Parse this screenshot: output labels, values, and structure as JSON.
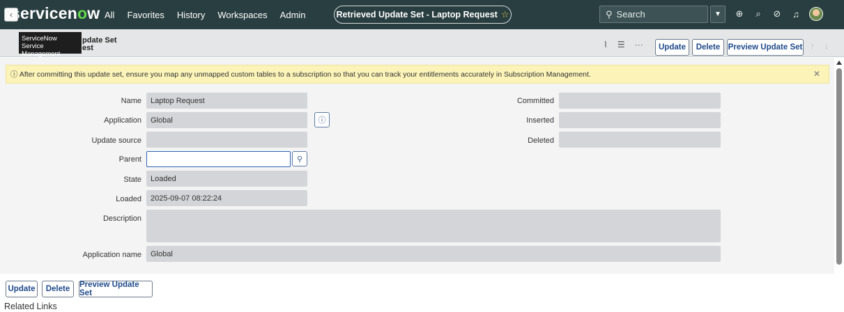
{
  "nav": {
    "logo_pre": "servicen",
    "logo_o": "o",
    "logo_post": "w",
    "links": [
      "All",
      "Favorites",
      "History",
      "Workspaces",
      "Admin"
    ],
    "record_title": "Retrieved Update Set - Laptop Request",
    "search_placeholder": "Search"
  },
  "tooltip": {
    "line1": "ServiceNow",
    "line2": "Service Management"
  },
  "header": {
    "title_line1": "pdate Set",
    "title_line2": "est",
    "update_label": "Update",
    "delete_label": "Delete",
    "preview_label": "Preview Update Set"
  },
  "banner": {
    "text": "ⓘ After committing this update set, ensure you map any unmapped custom tables to a subscription so that you can track your entitlements accurately in Subscription Management."
  },
  "form": {
    "name_label": "Name",
    "name_value": "Laptop Request",
    "application_label": "Application",
    "application_value": "Global",
    "update_source_label": "Update source",
    "update_source_value": "",
    "parent_label": "Parent",
    "parent_value": "",
    "state_label": "State",
    "state_value": "Loaded",
    "loaded_label": "Loaded",
    "loaded_value": "2025-09-07 08:22:24",
    "description_label": "Description",
    "description_value": "",
    "application_name_label": "Application name",
    "application_name_value": "Global",
    "committed_label": "Committed",
    "committed_value": "",
    "inserted_label": "Inserted",
    "inserted_value": "",
    "deleted_label": "Deleted",
    "deleted_value": ""
  },
  "footer": {
    "update_label": "Update",
    "delete_label": "Delete",
    "preview_label": "Preview Update Set",
    "related_links": "Related Links"
  }
}
